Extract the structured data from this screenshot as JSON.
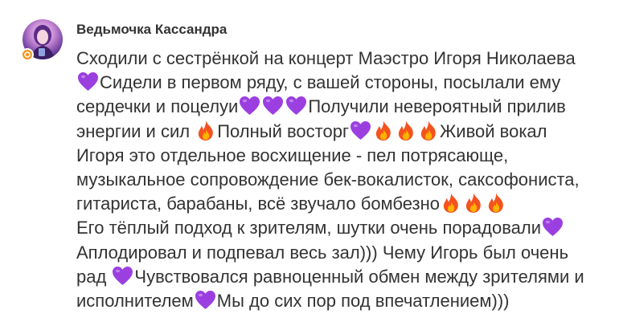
{
  "author": {
    "name": "Ведьмочка Кассандра",
    "badge_color": "#f7931e"
  },
  "colors": {
    "heart": "#9b3fe0",
    "fire_outer": "#f4521e",
    "fire_inner": "#ffb300",
    "text": "#333333"
  },
  "lines": [
    [
      "Сходили с сестрёнкой на концерт Маэстро Игоря Николаева"
    ],
    [
      {
        "icon": "purple-heart"
      },
      "Сидели в первом ряду, с вашей стороны, посылали ему"
    ],
    [
      "сердечки и поцелуи",
      {
        "icon": "purple-heart"
      },
      {
        "icon": "purple-heart"
      },
      {
        "icon": "purple-heart"
      },
      "Получили невероятный прилив"
    ],
    [
      "энергии и сил ",
      {
        "icon": "fire"
      },
      "Полный восторг",
      {
        "icon": "purple-heart"
      },
      {
        "icon": "fire"
      },
      {
        "icon": "fire"
      },
      {
        "icon": "fire"
      },
      "Живой вокал"
    ],
    [
      "Игоря это отдельное восхищение - пел потрясающе,"
    ],
    [
      "музыкальное сопровождение бек-вокалисток, саксофониста,"
    ],
    [
      "гитариста, барабаны, всё звучало бомбезно",
      {
        "icon": "fire"
      },
      {
        "icon": "fire"
      },
      {
        "icon": "fire"
      }
    ],
    [
      "Его тёплый подход к зрителям, шутки очень порадовали",
      {
        "icon": "purple-heart"
      }
    ],
    [
      "Аплодировал и подпевал весь зал))) Чему Игорь был очень"
    ],
    [
      "рад ",
      {
        "icon": "purple-heart"
      },
      "Чувствовался равноценный обмен между зрителями и"
    ],
    [
      "исполнителем",
      {
        "icon": "purple-heart"
      },
      "Мы до сих пор под впечатлением)))"
    ]
  ]
}
